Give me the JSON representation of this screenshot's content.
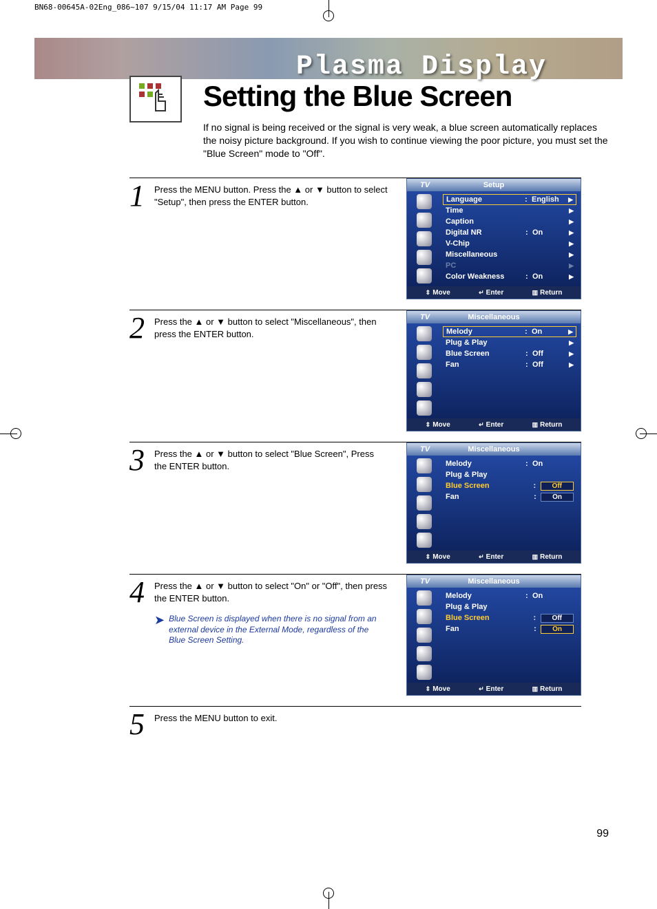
{
  "print_header": "BN68-00645A-02Eng_086~107  9/15/04  11:17 AM  Page 99",
  "banner_title": "Plasma Display",
  "page_title": "Setting the Blue Screen",
  "intro": "If no signal is being received or the signal is very weak, a blue screen automatically replaces the noisy picture background. If you wish to continue viewing the poor picture, you must set the \"Blue Screen\" mode to \"Off\".",
  "steps": {
    "s1": {
      "num": "1",
      "text": "Press the MENU button. Press the ▲ or ▼ button to select \"Setup\", then press the ENTER button."
    },
    "s2": {
      "num": "2",
      "text": "Press the ▲ or ▼ button to select \"Miscellaneous\", then press the ENTER button."
    },
    "s3": {
      "num": "3",
      "text": "Press the ▲ or ▼ button to select \"Blue Screen\", Press the ENTER button."
    },
    "s4": {
      "num": "4",
      "text": "Press the ▲ or ▼ button to select \"On\" or \"Off\", then press the ENTER button.",
      "note": "Blue Screen is displayed when there is no signal from an external device in the External Mode, regardless of the Blue Screen Setting."
    },
    "s5": {
      "num": "5",
      "text": "Press the MENU button to exit."
    }
  },
  "osd": {
    "tv": "TV",
    "footer": {
      "move": "Move",
      "enter": "Enter",
      "return": "Return"
    },
    "setup": {
      "title": "Setup",
      "rows": [
        {
          "label": "Language",
          "val": "English"
        },
        {
          "label": "Time",
          "val": ""
        },
        {
          "label": "Caption",
          "val": ""
        },
        {
          "label": "Digital NR",
          "val": "On"
        },
        {
          "label": "V-Chip",
          "val": ""
        },
        {
          "label": "Miscellaneous",
          "val": ""
        },
        {
          "label": "PC",
          "val": ""
        },
        {
          "label": "Color Weakness",
          "val": "On"
        }
      ]
    },
    "misc1": {
      "title": "Miscellaneous",
      "rows": [
        {
          "label": "Melody",
          "val": "On"
        },
        {
          "label": "Plug & Play",
          "val": ""
        },
        {
          "label": "Blue Screen",
          "val": "Off"
        },
        {
          "label": "Fan",
          "val": "Off"
        }
      ]
    },
    "misc2": {
      "title": "Miscellaneous",
      "melody": {
        "label": "Melody",
        "val": "On"
      },
      "plugplay": {
        "label": "Plug & Play"
      },
      "bluescreen": {
        "label": "Blue Screen"
      },
      "fan": {
        "label": "Fan"
      },
      "opt_off": "Off",
      "opt_on": "On"
    },
    "misc3": {
      "title": "Miscellaneous",
      "melody": {
        "label": "Melody",
        "val": "On"
      },
      "plugplay": {
        "label": "Plug & Play"
      },
      "bluescreen": {
        "label": "Blue Screen"
      },
      "fan": {
        "label": "Fan"
      },
      "opt_off": "Off",
      "opt_on": "On"
    }
  },
  "page_num": "99"
}
